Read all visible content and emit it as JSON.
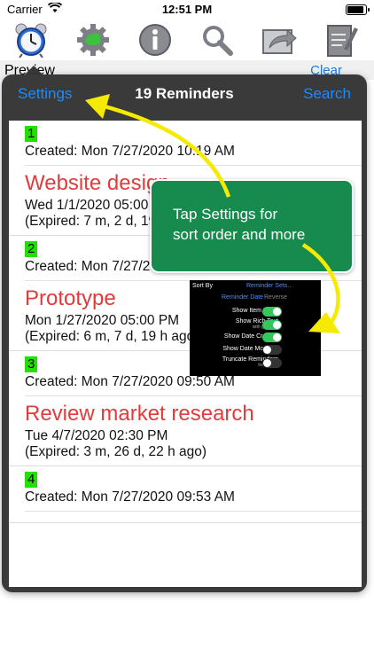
{
  "status_bar": {
    "carrier": "Carrier",
    "time": "12:51 PM"
  },
  "toolbar": {
    "icons": [
      "alarm-clock-icon",
      "cloud-settings-icon",
      "info-icon",
      "search-icon",
      "share-icon",
      "notepad-icon"
    ]
  },
  "under": {
    "preview_label": "Preview",
    "clear_label": "Clear"
  },
  "popover": {
    "settings_label": "Settings",
    "title": "19 Reminders",
    "search_label": "Search"
  },
  "reminders": [
    {
      "index": "1",
      "created": "Created: Mon 7/27/2020 10:19 AM",
      "title": "Website design",
      "due": "Wed 1/1/2020 05:00 PM",
      "expired": "(Expired: 7 m, 2 d, 19 h ago)"
    },
    {
      "index": "2",
      "created": "Created: Mon 7/27/2020 09:50 AM",
      "title": "Prototype",
      "due": "Mon 1/27/2020 05:00 PM",
      "expired": "(Expired: 6 m, 7 d, 19 h ago)"
    },
    {
      "index": "3",
      "created": "Created: Mon 7/27/2020 09:50 AM",
      "title": "Review market research",
      "due": "Tue 4/7/2020 02:30 PM",
      "expired": "(Expired: 3 m, 26 d, 22 h ago)"
    },
    {
      "index": "4",
      "created": "Created: Mon 7/27/2020 09:53 AM",
      "title": "",
      "due": "",
      "expired": ""
    }
  ],
  "callout": {
    "line1": "Tap Settings for",
    "line2": "sort order and more"
  },
  "mini_settings": {
    "sort_by": "Sort By",
    "reminder_sets": "Reminder Sets...",
    "reminder_date": "Reminder Date",
    "reverse": "Reverse",
    "rows": [
      {
        "label": "Show Item Index",
        "sub": "",
        "on": true
      },
      {
        "label": "Show Rich Text",
        "sub": "with graphics",
        "on": true
      },
      {
        "label": "Show Date Created",
        "sub": "",
        "on": true
      },
      {
        "label": "Show Date Modified",
        "sub": "",
        "on": false
      },
      {
        "label": "Truncate Reminders",
        "sub": "for display",
        "on": false
      }
    ]
  },
  "colors": {
    "accent": "#1a8cff",
    "reminder_title": "#e23b3b",
    "index_badge": "#22e000",
    "callout": "#178a4e",
    "arrow": "#f5ea00"
  }
}
